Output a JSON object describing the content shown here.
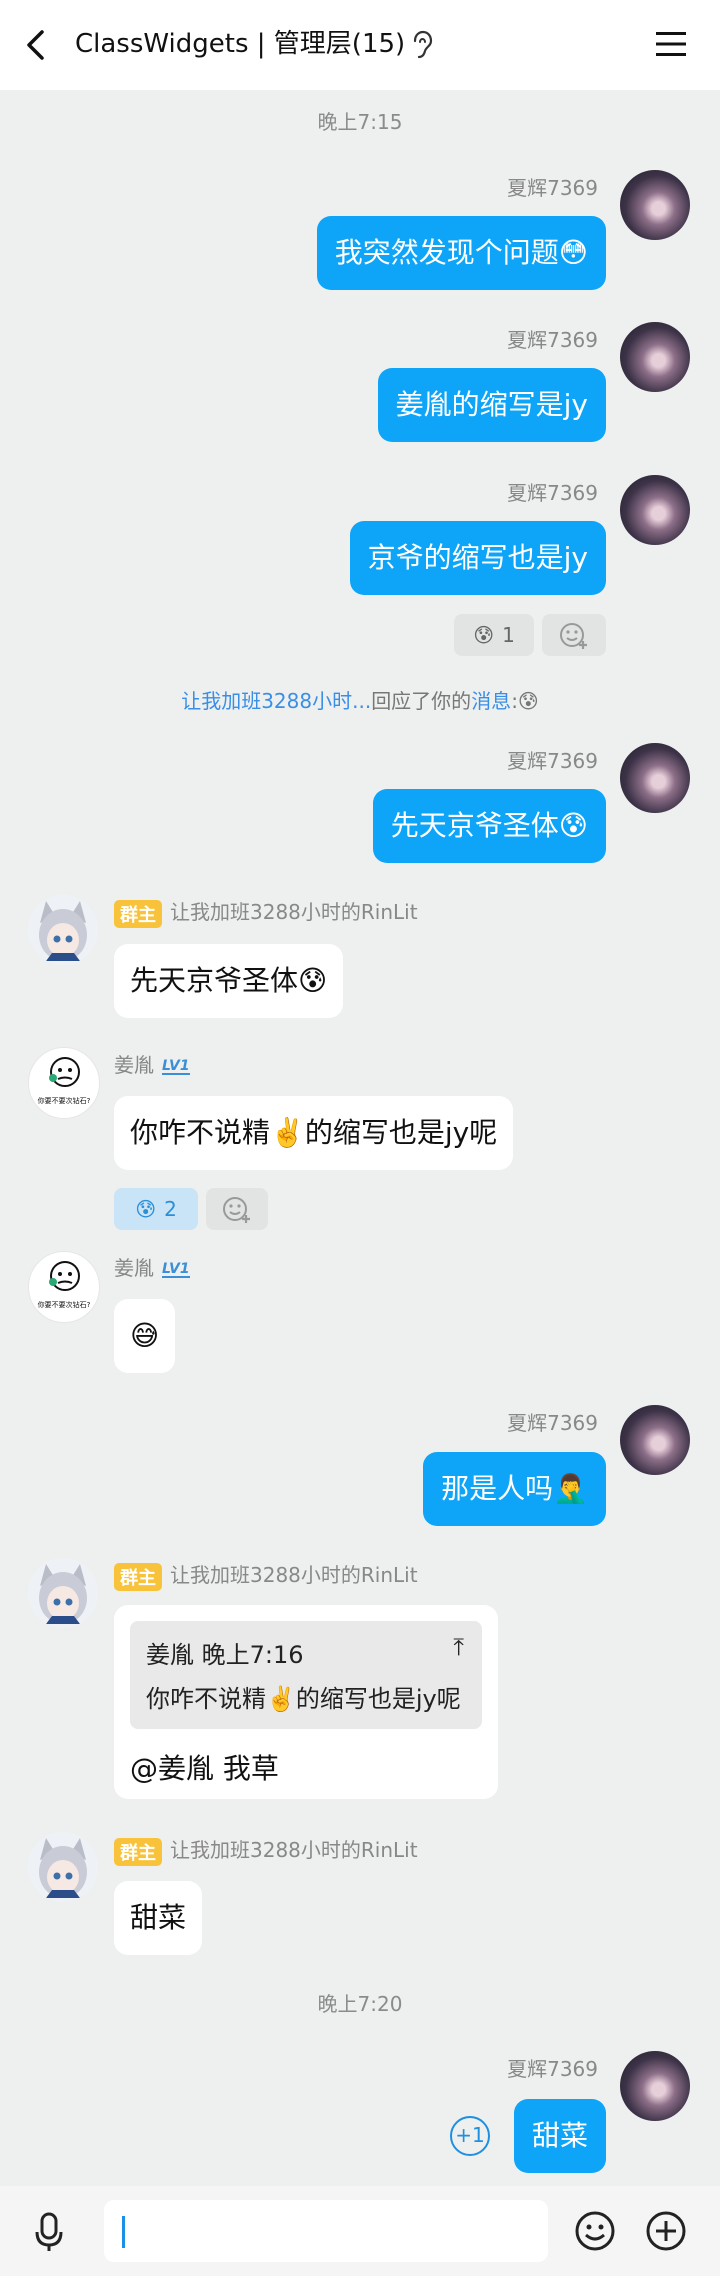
{
  "header": {
    "title": "ClassWidgets | 管理层(15)"
  },
  "times": [
    "晚上7:15",
    "晚上7:20"
  ],
  "messages": {
    "m1": {
      "sender": "夏辉7369",
      "text": "我突然发现个问题😳"
    },
    "m2": {
      "sender": "夏辉7369",
      "text": "姜胤的缩写是jy"
    },
    "m3": {
      "sender": "夏辉7369",
      "text": "京爷的缩写也是jy",
      "reaction_emoji": "😰",
      "reaction_count": "1"
    },
    "m4": {
      "sender": "夏辉7369",
      "text": "先天京爷圣体😰"
    },
    "m5": {
      "badge": "群主",
      "sender": "让我加班3288小时的RinLit",
      "text": "先天京爷圣体😰"
    },
    "m6": {
      "sender": "姜胤",
      "level": "LV1",
      "text": "你咋不说精✌️的缩写也是jy呢",
      "reaction_emoji": "😰",
      "reaction_count": "2"
    },
    "m7": {
      "sender": "姜胤",
      "level": "LV1",
      "text": "😅"
    },
    "m8": {
      "sender": "夏辉7369",
      "text": "那是人吗🤦‍♂️"
    },
    "m9": {
      "badge": "群主",
      "sender": "让我加班3288小时的RinLit",
      "quote_header": "姜胤 晚上7:16",
      "quote_text": "你咋不说精✌️的缩写也是jy呢",
      "text": "@姜胤 我草"
    },
    "m10": {
      "badge": "群主",
      "sender": "让我加班3288小时的RinLit",
      "text": "甜菜"
    },
    "m11": {
      "sender": "夏辉7369",
      "text": "甜菜",
      "plus_one": "+1"
    }
  },
  "notice": {
    "user": "让我加班3288小时...",
    "mid": "回应了你的",
    "link": "消息",
    "tail": ":😰"
  },
  "meme_caption": "你要不要次钻石?",
  "colors": {
    "bubble_out": "#0ea5f9",
    "badge": "#f8c33a",
    "link": "#3a8ee6"
  },
  "icons": [
    "chevron-left-icon",
    "ear-icon",
    "menu-icon",
    "microphone-icon",
    "emoji-icon",
    "plus-circle-icon",
    "add-reaction-icon"
  ]
}
